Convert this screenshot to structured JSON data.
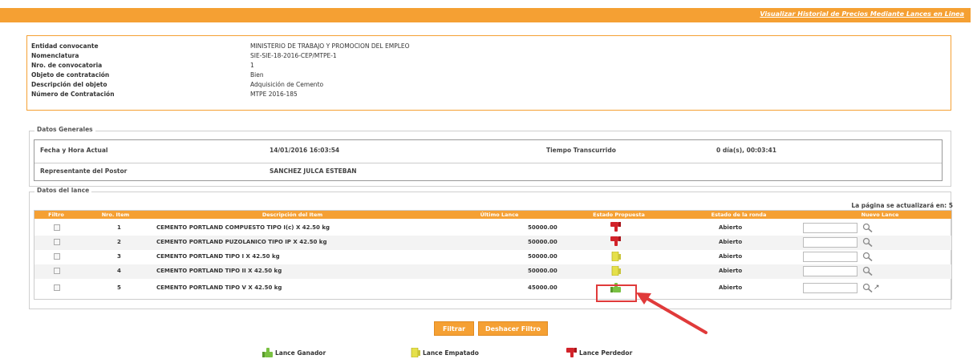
{
  "header": {
    "link_text": "Visualizar Historial de Precios Mediante Lances en Linea"
  },
  "info": {
    "rows": [
      {
        "label": "Entidad convocante",
        "value": "MINISTERIO DE TRABAJO Y PROMOCION DEL EMPLEO"
      },
      {
        "label": "Nomenclatura",
        "value": "SIE-SIE-18-2016-CEP/MTPE-1"
      },
      {
        "label": "Nro. de convocatoria",
        "value": "1"
      },
      {
        "label": "Objeto de contratación",
        "value": "Bien"
      },
      {
        "label": "Descripción del objeto",
        "value": "Adquisición de Cemento"
      },
      {
        "label": "Número de Contratación",
        "value": "MTPE 2016-185"
      }
    ]
  },
  "datos_generales": {
    "title": "Datos Generales",
    "fecha_label": "Fecha y Hora Actual",
    "fecha_value": "14/01/2016 16:03:54",
    "tiempo_label": "Tiempo Transcurrido",
    "tiempo_value": "0 día(s), 00:03:41",
    "rep_label": "Representante del Postor",
    "rep_value": "SANCHEZ JULCA ESTEBAN"
  },
  "datos_lance": {
    "title": "Datos del lance",
    "refresh_note": "La página se actualizará en: 5",
    "columns": [
      "Filtro",
      "Nro. Item",
      "Descripción del Item",
      "Último Lance",
      "Estado Propuesta",
      "Estado de la ronda",
      "Nuevo Lance"
    ],
    "rows": [
      {
        "item": "1",
        "desc": "CEMENTO PORTLAND COMPUESTO TIPO I(c) X 42.50 kg",
        "ultimo": "50000.00",
        "estado": "perdedor",
        "ronda": "Abierto"
      },
      {
        "item": "2",
        "desc": "CEMENTO PORTLAND PUZOLANICO TIPO IP X 42.50 kg",
        "ultimo": "50000.00",
        "estado": "perdedor",
        "ronda": "Abierto"
      },
      {
        "item": "3",
        "desc": "CEMENTO PORTLAND TIPO I X 42.50 kg",
        "ultimo": "50000.00",
        "estado": "empatado",
        "ronda": "Abierto"
      },
      {
        "item": "4",
        "desc": "CEMENTO PORTLAND TIPO II X 42.50 kg",
        "ultimo": "50000.00",
        "estado": "empatado",
        "ronda": "Abierto"
      },
      {
        "item": "5",
        "desc": "CEMENTO PORTLAND TIPO V X 42.50 kg",
        "ultimo": "45000.00",
        "estado": "ganador",
        "ronda": "Abierto"
      }
    ]
  },
  "buttons": {
    "filtrar": "Filtrar",
    "deshacer": "Deshacer Filtro"
  },
  "legend": {
    "ganador": "Lance Ganador",
    "empatado": "Lance Empatado",
    "perdedor": "Lance Perdedor"
  },
  "colors": {
    "accent": "#f5a033",
    "highlight": "#e03a3a",
    "ganador": "#7ac142",
    "empatado": "#e5e04a",
    "perdedor": "#d2232a"
  }
}
